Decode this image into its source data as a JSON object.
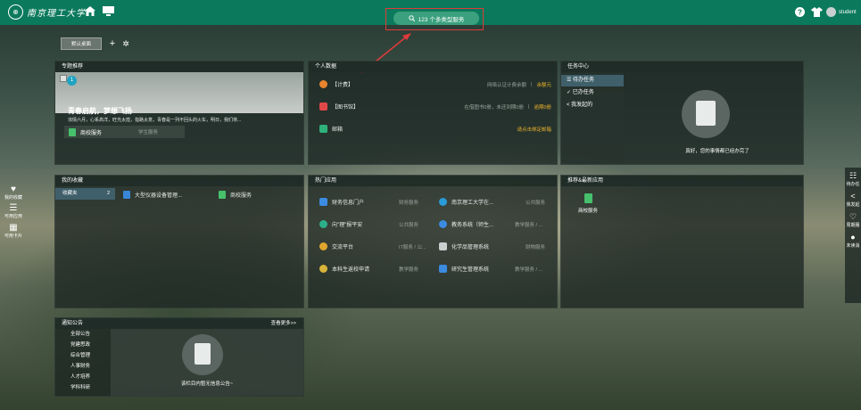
{
  "header": {
    "logo_seal": "⊛",
    "logo_text": "南京理工大学",
    "search_text": "123 个多类型服务",
    "user_name": "student",
    "colors": {
      "bar": "#0b7a5c",
      "search": "#3aa07d",
      "highlight": "#e03a3a"
    },
    "icons": [
      "home-icon",
      "monitor-icon",
      "help-icon",
      "shirt-icon",
      "search-icon"
    ]
  },
  "desktop": {
    "tab_label": "默认桌面",
    "add": "+",
    "settings": "✲"
  },
  "featured": {
    "title": "专题推荐",
    "badge": "1",
    "headline": "青春启航，梦想飞扬",
    "desc": "浓情六月，心系高洋，旺光太煌，指路太意，青春是一列不回头的火车，明日，我们将...",
    "app_name": "商校服务",
    "app_tag": "学生服务"
  },
  "personal": {
    "title": "个人数据",
    "rows": [
      {
        "label": "【计费】",
        "info": "网络认证计费余额",
        "sep": "|",
        "link": "余额元"
      },
      {
        "label": "【图书馆】",
        "info": "在借图书0册，未还到期0册",
        "sep": "|",
        "link": "逾期0册"
      },
      {
        "label": "邮箱",
        "info": "",
        "sep": "",
        "link": "请点击绑定邮箱"
      }
    ]
  },
  "tasks": {
    "title": "任务中心",
    "items": [
      "待办任务",
      "已办任务",
      "我发起的"
    ],
    "empty_text": "真好，您的事情都已经办完了"
  },
  "favorites": {
    "title": "我的收藏",
    "folder": "收藏夹",
    "count": "2",
    "items": [
      "大型仪器设备管理...",
      "商校服务"
    ]
  },
  "hot_apps": {
    "title": "热门应用",
    "apps": [
      {
        "name": "财务信息门户",
        "tag": "财务服务"
      },
      {
        "name": "南京理工大学在...",
        "tag": "公共服务"
      },
      {
        "name": "向\"理\"报平安",
        "tag": "公共服务"
      },
      {
        "name": "教务系统（师生...",
        "tag": "教学服务 / ..."
      },
      {
        "name": "交流平台",
        "tag": "IT服务 / 公..."
      },
      {
        "name": "化学品管理系统",
        "tag": "财物服务"
      },
      {
        "name": "本科生返校申请",
        "tag": "教学服务"
      },
      {
        "name": "研究生管理系统",
        "tag": "教学服务 / ..."
      }
    ]
  },
  "recommend": {
    "title": "推荐&最新应用",
    "app": "商校服务"
  },
  "notice": {
    "title": "通知公告",
    "more": "查看更多>>",
    "categories": [
      "全部公告",
      "党建思政",
      "综合管理",
      "人事财务",
      "人才培养",
      "学科科研"
    ],
    "empty_text": "该栏目内暂无信息公告~"
  },
  "left_sidebar": [
    {
      "icon": "♥",
      "label": "我的收藏"
    },
    {
      "icon": "☰",
      "label": "可用应用"
    },
    {
      "icon": "▦",
      "label": "可用卡片"
    }
  ],
  "right_sidebar": [
    {
      "icon": "☷",
      "label": "待办任"
    },
    {
      "icon": "<",
      "label": "我发起"
    },
    {
      "icon": "♡",
      "label": "周期服"
    },
    {
      "icon": "●",
      "label": "未读消"
    }
  ]
}
